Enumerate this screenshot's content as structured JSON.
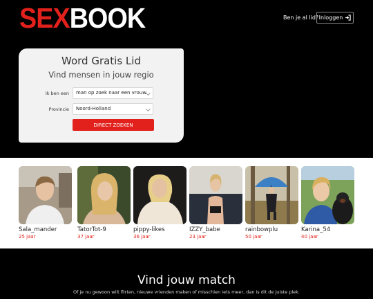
{
  "header": {
    "logo_red": "SEX",
    "logo_white": "BOOK",
    "already_member": "Ben je al lid?",
    "login_label": "Inloggen"
  },
  "signup": {
    "title": "Word Gratis Lid",
    "subtitle": "Vind mensen in jouw regio",
    "iam_label": "Ik ben een",
    "iam_value": "man op zoek naar een vrouw",
    "province_label": "Provincie",
    "province_value": "Noord-Holland",
    "submit_label": "DIRECT ZOEKEN"
  },
  "profiles": [
    {
      "name": "Sala_mander",
      "age": "25 jaar"
    },
    {
      "name": "TatorTot-9",
      "age": "37 jaar"
    },
    {
      "name": "pippy-likes",
      "age": "36 jaar"
    },
    {
      "name": "IZZY_babe",
      "age": "23 jaar"
    },
    {
      "name": "rainbowplu",
      "age": "50 jaar"
    },
    {
      "name": "Karina_54",
      "age": "40 jaar"
    }
  ],
  "match": {
    "title": "Vind jouw match",
    "subtitle": "Of je nu gewoon wilt flirten, nieuwe vrienden maken of misschien iets meer, dan is dit de juiste plek."
  },
  "colors": {
    "accent": "#e2211c",
    "background": "#000000",
    "card": "#f2f2f2"
  },
  "icons": {
    "login": "sign-in-icon",
    "dropdown": "chevron-down-icon"
  }
}
